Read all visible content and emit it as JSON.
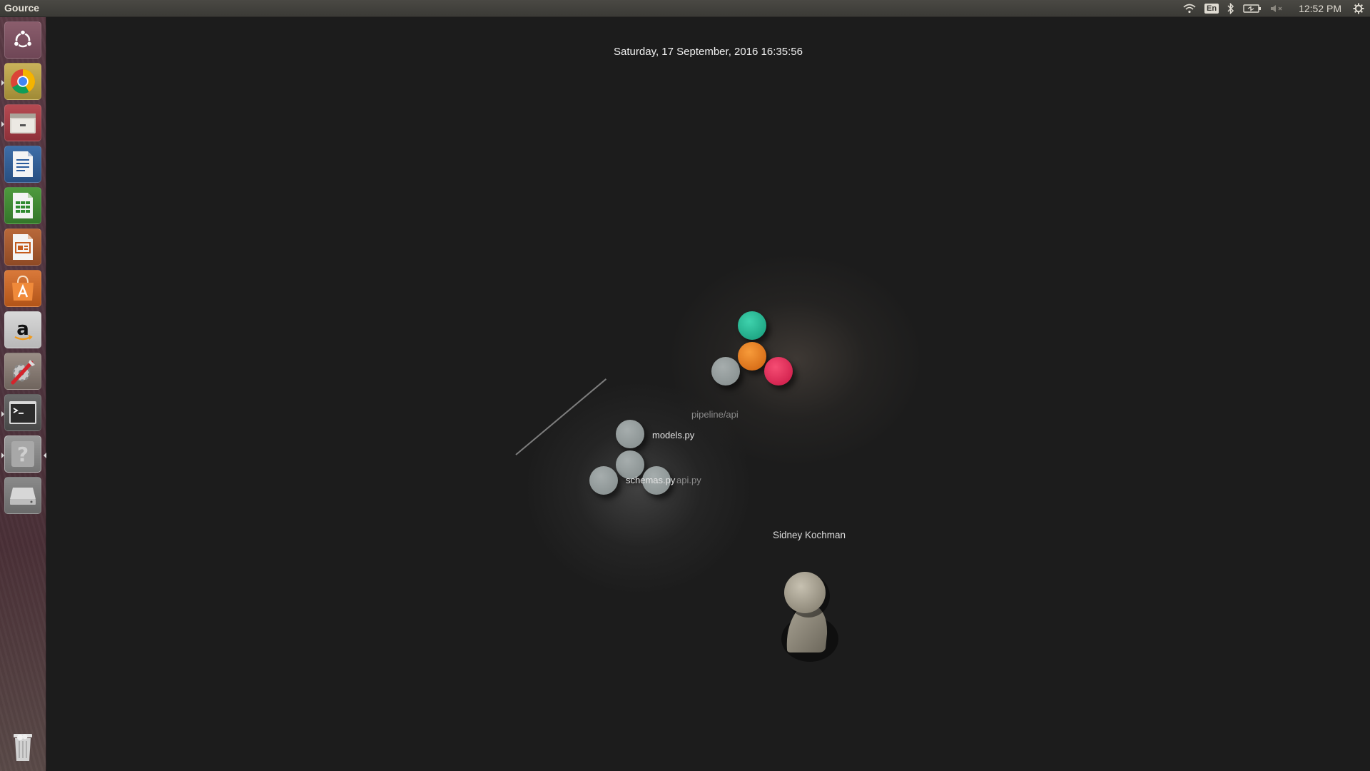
{
  "top_panel": {
    "app_title": "Gource",
    "keyboard_layout": "En",
    "clock": "12:52 PM",
    "icons": [
      "wifi-icon",
      "keyboard-layout-indicator",
      "bluetooth-icon",
      "battery-icon",
      "volume-muted-icon",
      "settings-gear-icon"
    ]
  },
  "launcher": {
    "items": [
      {
        "name": "ubuntu-dash",
        "icon": "ubuntu-logo-icon"
      },
      {
        "name": "chrome",
        "icon": "chrome-icon",
        "running": true
      },
      {
        "name": "files",
        "icon": "file-manager-icon",
        "running": true
      },
      {
        "name": "writer",
        "icon": "libreoffice-writer-icon"
      },
      {
        "name": "calc",
        "icon": "libreoffice-calc-icon"
      },
      {
        "name": "impress",
        "icon": "libreoffice-impress-icon"
      },
      {
        "name": "software-center",
        "icon": "shopping-bag-icon"
      },
      {
        "name": "amazon",
        "icon": "amazon-icon"
      },
      {
        "name": "system-settings",
        "icon": "settings-tools-icon"
      },
      {
        "name": "terminal",
        "icon": "terminal-icon",
        "running": true
      },
      {
        "name": "gource",
        "icon": "unknown-app-icon",
        "running": true,
        "focused": true
      },
      {
        "name": "drive",
        "icon": "disk-drive-icon"
      },
      {
        "name": "trash",
        "icon": "trash-icon"
      }
    ]
  },
  "visualization": {
    "date": "Saturday, 17 September, 2016 16:35:56",
    "directory_label": "pipeline/api",
    "files": [
      {
        "label": "models.py"
      },
      {
        "label": "schemas.py"
      },
      {
        "label": "api.py"
      }
    ],
    "colored_nodes": [
      {
        "color": "#2bbd9b"
      },
      {
        "color": "#e8821f"
      },
      {
        "color": "#e8365f"
      }
    ],
    "user": {
      "name": "Sidney Kochman"
    }
  }
}
